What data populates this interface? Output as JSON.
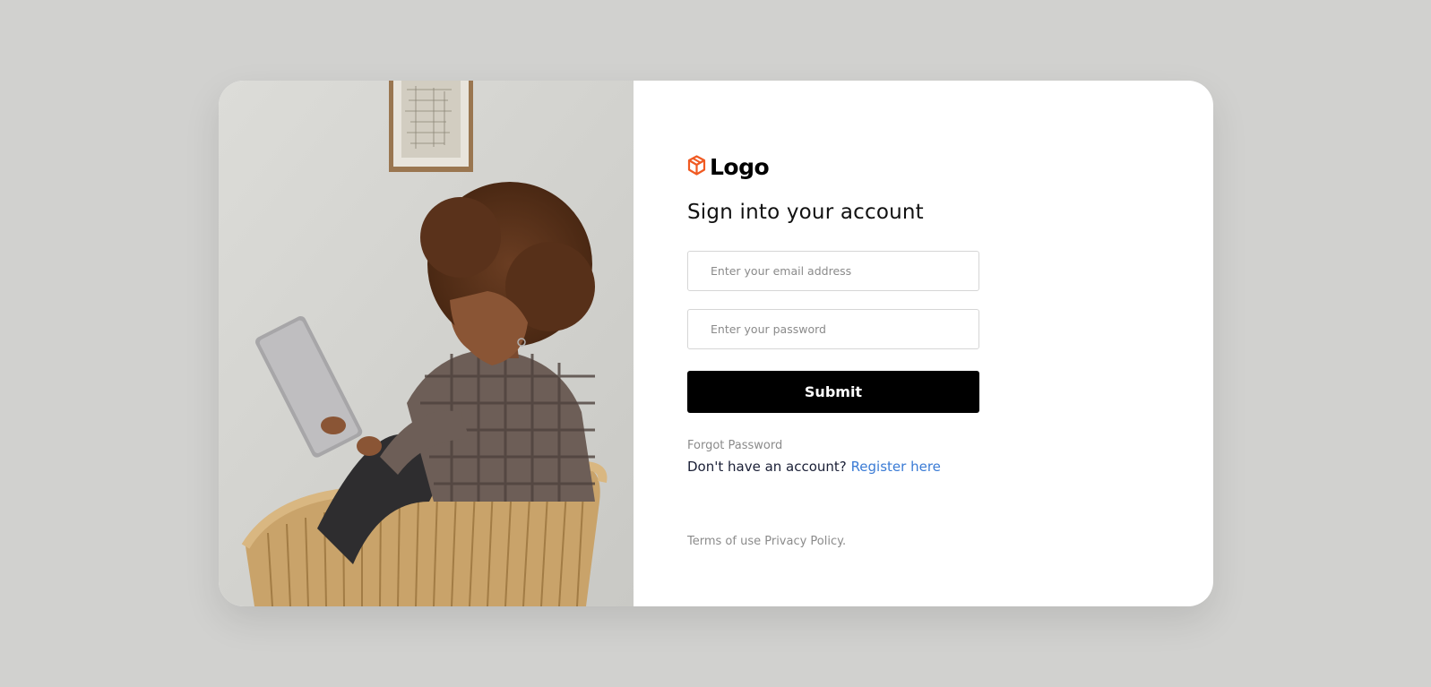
{
  "brand": {
    "logo_text": "Logo",
    "logo_icon": "cube-icon",
    "accent_color": "#f05a22"
  },
  "photo": {
    "subject": "woman-reading-tablet-in-wicker-chair"
  },
  "form": {
    "title": "Sign into your account",
    "email_placeholder": "Enter your email address",
    "password_placeholder": "Enter your password",
    "submit_label": "Submit",
    "forgot_label": "Forgot Password",
    "register_prompt": "Don't have an account?",
    "register_link": "Register here"
  },
  "footer": {
    "terms_label": "Terms of use",
    "privacy_label": "Privacy Policy."
  },
  "colors": {
    "page_background": "#d1d1cf",
    "card_background": "#ffffff",
    "button_background": "#000000",
    "link_color": "#3a7bd5",
    "muted_text": "#8b8b8b"
  }
}
